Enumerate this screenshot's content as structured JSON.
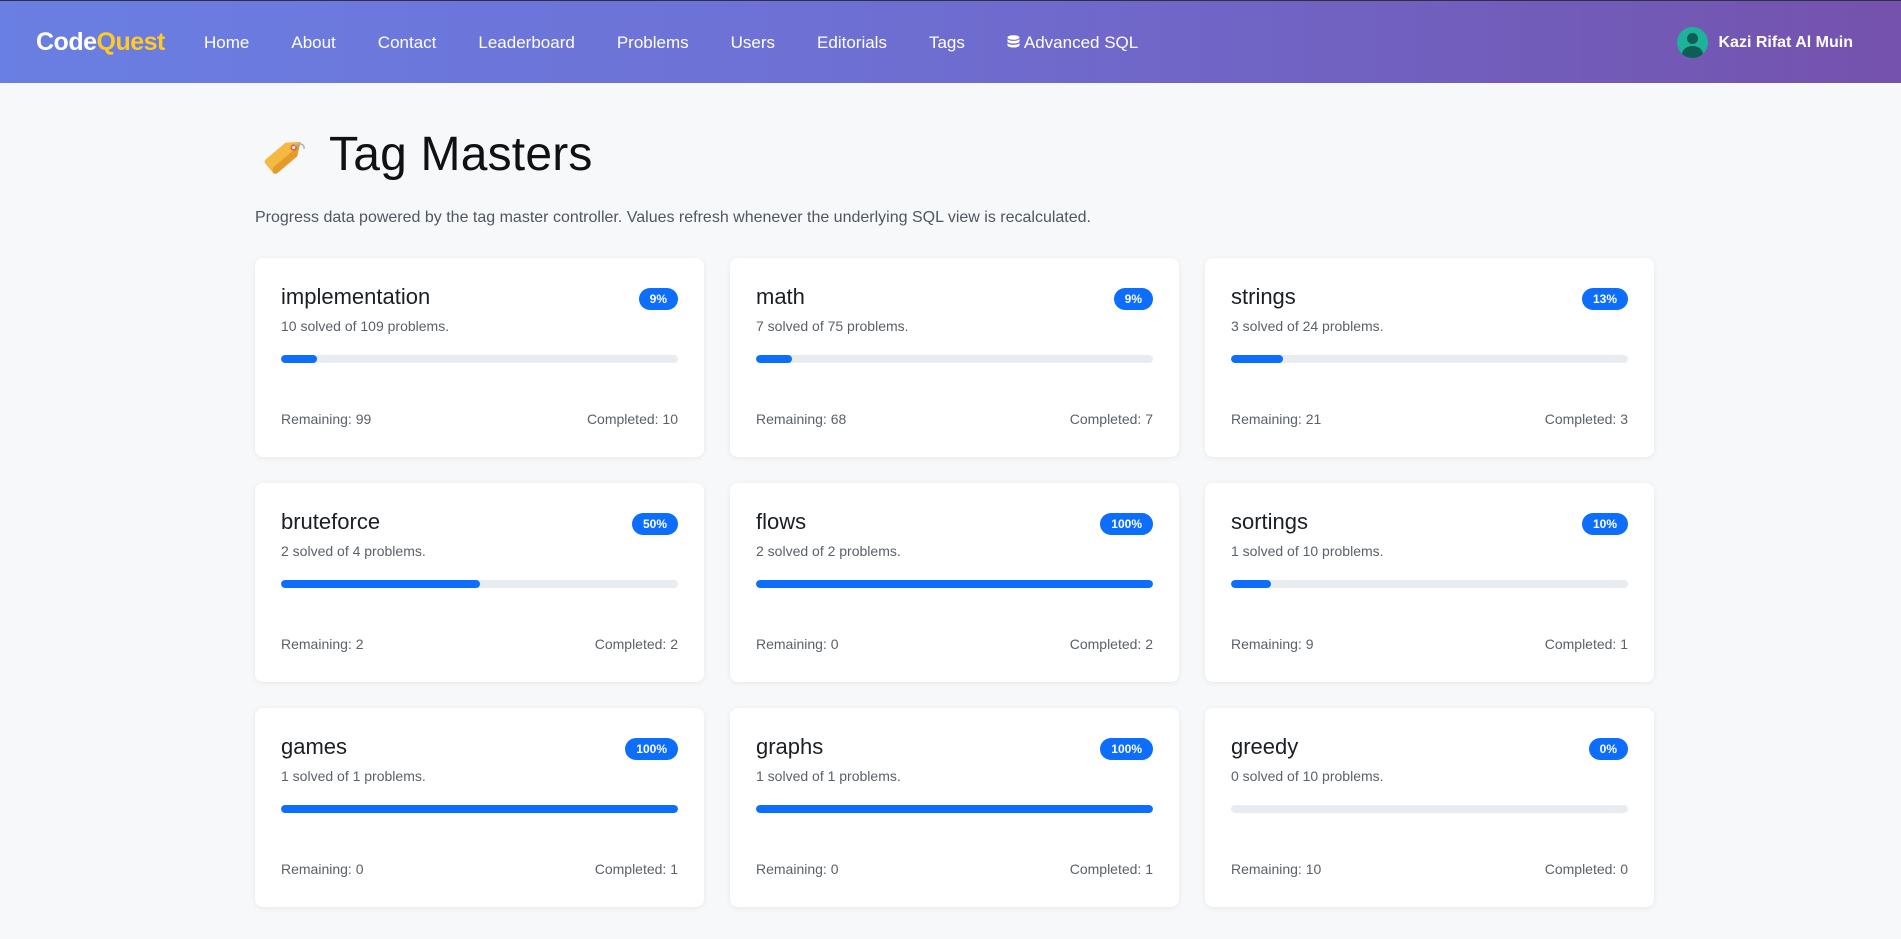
{
  "brand": {
    "part1": "Code",
    "part2": "Quest"
  },
  "nav": {
    "items": [
      {
        "label": "Home"
      },
      {
        "label": "About"
      },
      {
        "label": "Contact"
      },
      {
        "label": "Leaderboard"
      },
      {
        "label": "Problems"
      },
      {
        "label": "Users"
      },
      {
        "label": "Editorials"
      },
      {
        "label": "Tags"
      },
      {
        "label": "Advanced SQL"
      }
    ]
  },
  "user": {
    "name": "Kazi Rifat Al Muin"
  },
  "page": {
    "title": "Tag Masters",
    "description": "Progress data powered by the tag master controller. Values refresh whenever the underlying SQL view is recalculated."
  },
  "labels": {
    "remaining": "Remaining: ",
    "completed": "Completed: "
  },
  "tags": [
    {
      "name": "implementation",
      "solved": 10,
      "total": 109,
      "percent": 9,
      "badge": "9%",
      "sub": "10 solved of 109 problems.",
      "remaining": "99",
      "completed": "10"
    },
    {
      "name": "math",
      "solved": 7,
      "total": 75,
      "percent": 9,
      "badge": "9%",
      "sub": "7 solved of 75 problems.",
      "remaining": "68",
      "completed": "7"
    },
    {
      "name": "strings",
      "solved": 3,
      "total": 24,
      "percent": 13,
      "badge": "13%",
      "sub": "3 solved of 24 problems.",
      "remaining": "21",
      "completed": "3"
    },
    {
      "name": "bruteforce",
      "solved": 2,
      "total": 4,
      "percent": 50,
      "badge": "50%",
      "sub": "2 solved of 4 problems.",
      "remaining": "2",
      "completed": "2"
    },
    {
      "name": "flows",
      "solved": 2,
      "total": 2,
      "percent": 100,
      "badge": "100%",
      "sub": "2 solved of 2 problems.",
      "remaining": "0",
      "completed": "2"
    },
    {
      "name": "sortings",
      "solved": 1,
      "total": 10,
      "percent": 10,
      "badge": "10%",
      "sub": "1 solved of 10 problems.",
      "remaining": "9",
      "completed": "1"
    },
    {
      "name": "games",
      "solved": 1,
      "total": 1,
      "percent": 100,
      "badge": "100%",
      "sub": "1 solved of 1 problems.",
      "remaining": "0",
      "completed": "1"
    },
    {
      "name": "graphs",
      "solved": 1,
      "total": 1,
      "percent": 100,
      "badge": "100%",
      "sub": "1 solved of 1 problems.",
      "remaining": "0",
      "completed": "1"
    },
    {
      "name": "greedy",
      "solved": 0,
      "total": 10,
      "percent": 0,
      "badge": "0%",
      "sub": "0 solved of 10 problems.",
      "remaining": "10",
      "completed": "0"
    }
  ],
  "colors": {
    "accent": "#0d6efd",
    "brand_highlight": "#ffc928",
    "track": "#e9ecef"
  },
  "icons": {
    "title": "tag-icon",
    "sql": "database-icon",
    "user": "user-avatar-icon"
  }
}
